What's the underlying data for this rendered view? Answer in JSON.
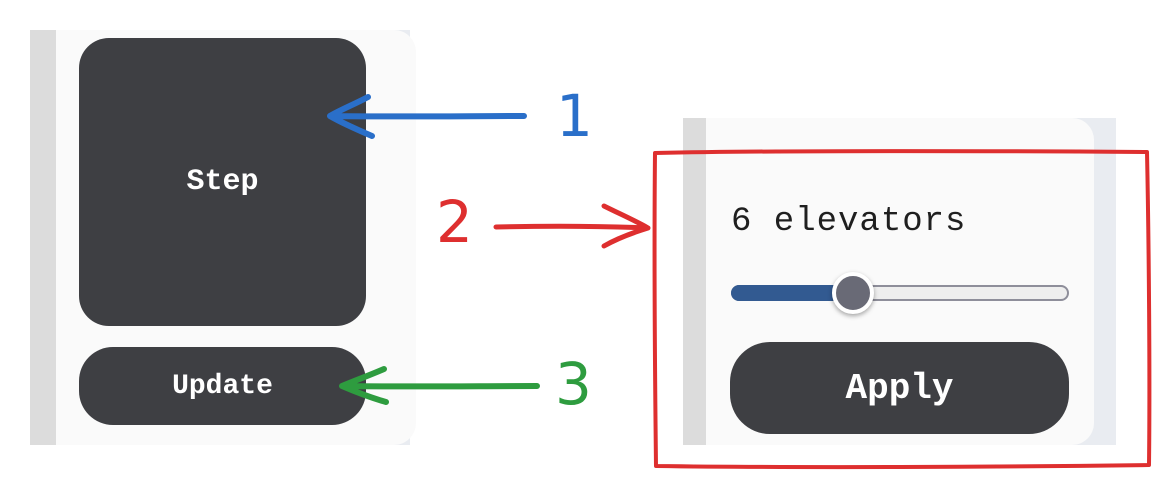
{
  "left_panel": {
    "step_button": "Step",
    "update_button": "Update"
  },
  "right_panel": {
    "elevator_label": "6 elevators",
    "slider": {
      "value": 6,
      "fill_fraction": 0.36
    },
    "apply_button": "Apply"
  },
  "annotations": [
    {
      "label": "1",
      "color": "#2a6fc9"
    },
    {
      "label": "2",
      "color": "#de2f2f"
    },
    {
      "label": "3",
      "color": "#2e9c3f"
    }
  ],
  "colors": {
    "button_bg": "#3e3f43",
    "slider_fill": "#325a91",
    "highlight_box": "#de2f2f"
  }
}
